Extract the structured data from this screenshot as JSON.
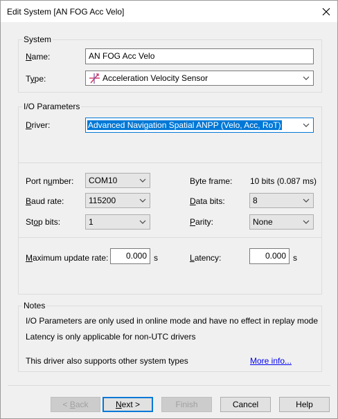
{
  "window": {
    "title": "Edit System [AN FOG Acc Velo]"
  },
  "system": {
    "group_label": "System",
    "name_label": "Name:",
    "name_value": "AN FOG Acc Velo",
    "type_label": "Type:",
    "type_value": "Acceleration Velocity Sensor"
  },
  "io": {
    "group_label": "I/O Parameters",
    "driver_label": "Driver:",
    "driver_value": "Advanced Navigation Spatial ANPP (Velo, Acc, RoT)",
    "port_label": "Port number:",
    "port_value": "COM10",
    "baud_label": "Baud rate:",
    "baud_value": "115200",
    "stop_label": "Stop bits:",
    "stop_value": "1",
    "byteframe_label": "Byte frame:",
    "byteframe_value": "10 bits (0.087 ms)",
    "databits_label": "Data bits:",
    "databits_value": "8",
    "parity_label": "Parity:",
    "parity_value": "None",
    "maxrate_label": "Maximum update rate:",
    "maxrate_value": "0.000",
    "maxrate_unit": "s",
    "latency_label": "Latency:",
    "latency_value": "0.000",
    "latency_unit": "s"
  },
  "notes": {
    "group_label": "Notes",
    "line1": "I/O Parameters are only used in online mode and have no effect in replay mode",
    "line2": "Latency is only applicable for non-UTC drivers",
    "line3": "This driver also supports other system types",
    "link": "More info..."
  },
  "buttons": {
    "back": "< Back",
    "next": "Next >",
    "finish": "Finish",
    "cancel": "Cancel",
    "help": "Help"
  }
}
